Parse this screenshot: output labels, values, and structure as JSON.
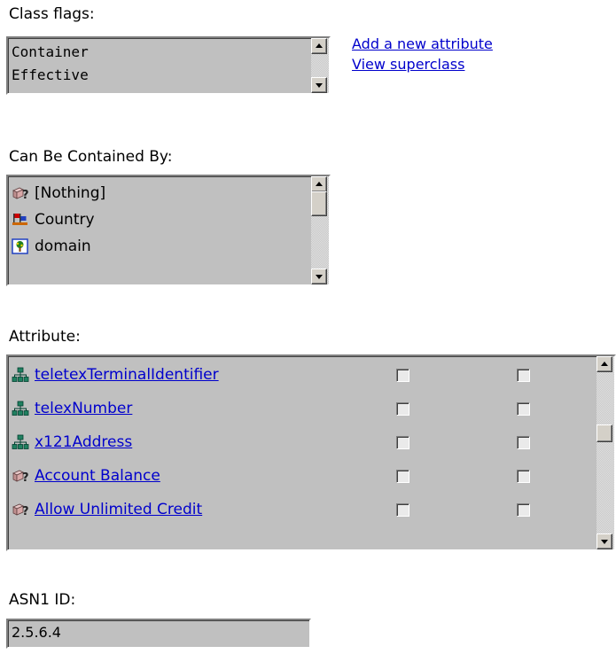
{
  "class_flags": {
    "label": "Class flags:",
    "items": [
      "Container",
      "Effective"
    ]
  },
  "links": {
    "add_attribute": "Add a new attribute",
    "view_superclass": "View superclass"
  },
  "contained_by": {
    "label": "Can Be Contained By:",
    "items": [
      {
        "label": "[Nothing]",
        "icon": "unknown-object-icon"
      },
      {
        "label": "Country",
        "icon": "country-icon"
      },
      {
        "label": "domain",
        "icon": "domain-icon"
      }
    ]
  },
  "attributes": {
    "label": "Attribute:",
    "rows": [
      {
        "name": "teletexTerminalIdentifier",
        "icon": "attribute-icon",
        "flag1": false,
        "flag2": false
      },
      {
        "name": "telexNumber",
        "icon": "attribute-icon",
        "flag1": false,
        "flag2": false
      },
      {
        "name": "x121Address",
        "icon": "attribute-icon",
        "flag1": false,
        "flag2": false
      },
      {
        "name": "Account Balance",
        "icon": "unknown-object-icon",
        "flag1": false,
        "flag2": false
      },
      {
        "name": "Allow Unlimited Credit",
        "icon": "unknown-object-icon",
        "flag1": false,
        "flag2": false
      }
    ]
  },
  "asn1": {
    "label": "ASN1 ID:",
    "value": "2.5.6.4"
  }
}
